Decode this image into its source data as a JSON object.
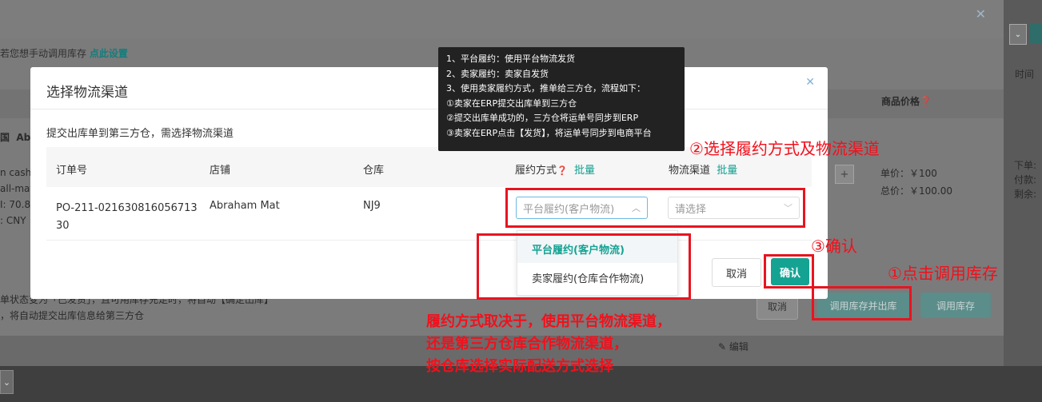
{
  "background": {
    "tip_text": "若您想手动调用库存",
    "tip_link": "点此设置",
    "col_time": "时间",
    "col_price": "商品价格",
    "country_prefix": "国",
    "shop_prefix": "Ab",
    "left_lines": [
      "n cash",
      "all-mat",
      "I: 70.8",
      ": CNY"
    ],
    "unit_price": "单价：￥100",
    "total_price": "总价：￥100.00",
    "right_lines": [
      "下单:",
      "付款:",
      "剩余:"
    ],
    "status_note_1": "单状态变为「已发货」，且可用库存充足时，将自动【确定出库】",
    "status_note_2": "，将自动提交出库信息给第三方仓",
    "edit_label": "编辑",
    "cancel_label": "取消",
    "call_and_out_label": "调用库存并出库",
    "call_label": "调用库存",
    "plus_label": "+"
  },
  "modal": {
    "title": "选择物流渠道",
    "description": "提交出库单到第三方仓，需选择物流渠道",
    "headers": {
      "order_no": "订单号",
      "shop": "店铺",
      "warehouse": "仓库",
      "fulfillment": "履约方式",
      "batch": "批量",
      "channel": "物流渠道",
      "batch2": "批量"
    },
    "row": {
      "order_no_line1": "PO-211-021630816056713",
      "order_no_line2": "30",
      "shop": "Abraham Mat",
      "warehouse": "NJ9",
      "fulfillment_value": "平台履约(客户物流)",
      "channel_placeholder": "请选择"
    },
    "dropdown_options": [
      "平台履约(客户物流)",
      "卖家履约(仓库合作物流)"
    ],
    "cancel_label": "取消",
    "ok_label": "确认"
  },
  "tooltip": {
    "lines": [
      "1、平台履约：使用平台物流发货",
      "2、卖家履约：卖家自发货",
      "3、使用卖家履约方式，推单给三方仓，流程如下：",
      "①卖家在ERP提交出库单到三方仓",
      "②提交出库单成功的，三方仓将运单号同步到ERP",
      "③卖家在ERP点击【发货】，将运单号同步到电商平台"
    ]
  },
  "annotations": {
    "step2": "②选择履约方式及物流渠道",
    "step3": "③确认",
    "step1": "①点击调用库存",
    "note_lines": [
      "履约方式取决于，使用平台物流渠道，",
      "还是第三方仓库合作物流渠道，",
      "按仓库选择实际配送方式选择"
    ]
  },
  "colors": {
    "accent": "#14a393",
    "annotation_red": "#e8141f",
    "tooltip_bg": "#222222"
  }
}
